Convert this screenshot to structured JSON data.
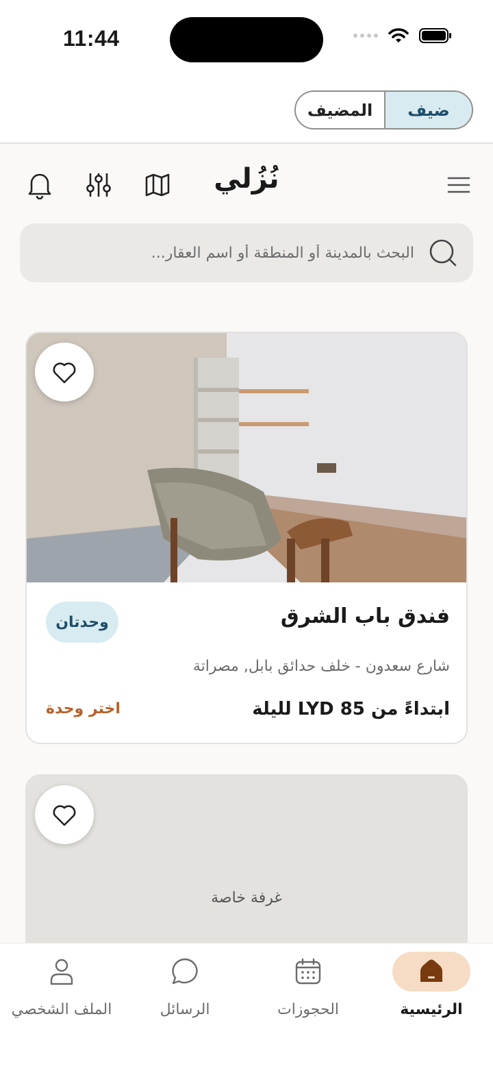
{
  "status_bar": {
    "time": "11:44"
  },
  "role_toggle": {
    "guest": "ضيف",
    "host": "المضيف",
    "selected": "guest"
  },
  "header": {
    "brand": "نُزُلي"
  },
  "search": {
    "placeholder": "البحث بالمدينة أو المنطقة أو اسم العقار..."
  },
  "listings": [
    {
      "title": "فندق باب الشرق",
      "badge": "وحدتان",
      "address": "شارع سعدون - خلف حدائق بابل, مصراتة",
      "price": "ابتداءً من 85 LYD لليلة",
      "action": "اختر وحدة"
    },
    {
      "placeholder": "غرفة خاصة"
    }
  ],
  "bottom_nav": [
    {
      "label": "الرئيسية",
      "icon": "home-icon",
      "active": true
    },
    {
      "label": "الحجوزات",
      "icon": "calendar-icon",
      "active": false
    },
    {
      "label": "الرسائل",
      "icon": "chat-icon",
      "active": false
    },
    {
      "label": "الملف الشخصي",
      "icon": "user-icon",
      "active": false
    }
  ],
  "colors": {
    "accent": "#b5622a",
    "badge_bg": "#d8ebf1",
    "active_tab_bg": "#f6dcc4"
  }
}
